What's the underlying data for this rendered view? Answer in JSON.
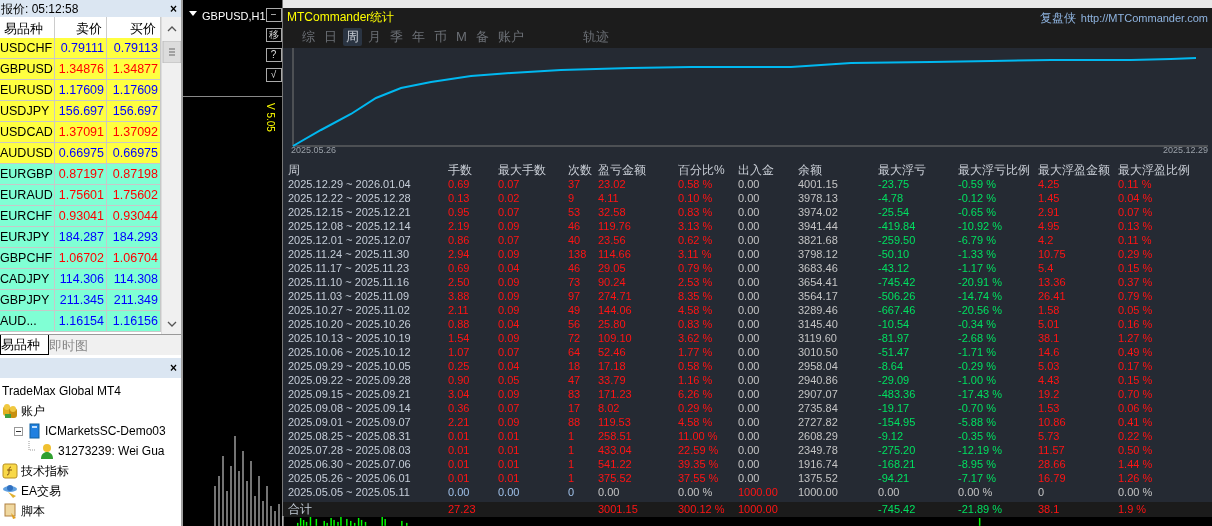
{
  "quotes": {
    "title": "报价: 05:12:58",
    "close": "×",
    "columns": [
      "易品种",
      "卖价",
      "买价"
    ],
    "rows": [
      {
        "symbol": "USDCHF",
        "bid": "0.79111",
        "ask": "0.79113",
        "kind": "major",
        "color": "#0000ff"
      },
      {
        "symbol": "GBPUSD",
        "bid": "1.34876",
        "ask": "1.34877",
        "kind": "major",
        "color": "#ff0000"
      },
      {
        "symbol": "EURUSD",
        "bid": "1.17609",
        "ask": "1.17609",
        "kind": "major",
        "color": "#0000ff"
      },
      {
        "symbol": "USDJPY",
        "bid": "156.697",
        "ask": "156.697",
        "kind": "major",
        "color": "#0000ff"
      },
      {
        "symbol": "USDCAD",
        "bid": "1.37091",
        "ask": "1.37092",
        "kind": "major",
        "color": "#ff0000"
      },
      {
        "symbol": "AUDUSD",
        "bid": "0.66975",
        "ask": "0.66975",
        "kind": "major",
        "color": "#0000ff"
      },
      {
        "symbol": "EURGBP",
        "bid": "0.87197",
        "ask": "0.87198",
        "kind": "cross",
        "color": "#ff0000"
      },
      {
        "symbol": "EURAUD",
        "bid": "1.75601",
        "ask": "1.75602",
        "kind": "cross",
        "color": "#ff0000"
      },
      {
        "symbol": "EURCHF",
        "bid": "0.93041",
        "ask": "0.93044",
        "kind": "cross",
        "color": "#ff0000"
      },
      {
        "symbol": "EURJPY",
        "bid": "184.287",
        "ask": "184.293",
        "kind": "cross",
        "color": "#0000ff"
      },
      {
        "symbol": "GBPCHF",
        "bid": "1.06702",
        "ask": "1.06704",
        "kind": "cross",
        "color": "#ff0000"
      },
      {
        "symbol": "CADJPY",
        "bid": "114.306",
        "ask": "114.308",
        "kind": "cross",
        "color": "#0000ff"
      },
      {
        "symbol": "GBPJPY",
        "bid": "211.345",
        "ask": "211.349",
        "kind": "cross",
        "color": "#0000ff"
      },
      {
        "symbol": "AUD...",
        "bid": "1.16154",
        "ask": "1.16156",
        "kind": "cross",
        "color": "#0000ff"
      }
    ]
  },
  "quote_tabs": [
    {
      "label": "易品种",
      "selected": true
    },
    {
      "label": "即时图",
      "selected": false
    }
  ],
  "navigator": {
    "close": "×",
    "root": "TradeMax Global MT4",
    "items": [
      {
        "label": "账户",
        "kind": "accounts",
        "children": [
          {
            "label": "ICMarketsSC-Demo03",
            "kind": "server",
            "expanded": true,
            "children": [
              {
                "label": "31273239: Wei Gua",
                "kind": "user"
              }
            ]
          }
        ]
      },
      {
        "label": "技术指标",
        "kind": "indicators"
      },
      {
        "label": "EA交易",
        "kind": "experts"
      },
      {
        "label": "脚本",
        "kind": "scripts"
      }
    ]
  },
  "chart_window": {
    "title": "GBPUSD,H1",
    "buttons": [
      "−",
      "移",
      "?",
      "√"
    ],
    "version": "V 5.05"
  },
  "stats": {
    "title": "MTCommander统计",
    "brand": "复盘侠",
    "url": "http://MTCommander.com",
    "tabs": [
      {
        "label": "综",
        "selected": false
      },
      {
        "label": "日",
        "selected": false
      },
      {
        "label": "周",
        "selected": true
      },
      {
        "label": "月",
        "selected": false
      },
      {
        "label": "季",
        "selected": false
      },
      {
        "label": "年",
        "selected": false
      },
      {
        "label": "币",
        "selected": false
      },
      {
        "label": "M",
        "selected": false
      },
      {
        "label": "备",
        "selected": false
      },
      {
        "label": "账户",
        "selected": false
      },
      {
        "label": "轨迹",
        "selected": false
      }
    ],
    "equity_chart": {
      "start_label": "2025.05.26",
      "end_label": "2025.12.29"
    },
    "table": {
      "columns": [
        "周",
        "手数",
        "最大手数",
        "次数",
        "盈亏金额",
        "百分比%",
        "出入金",
        "余额",
        "最大浮亏",
        "最大浮亏比例",
        "最大浮盈金额",
        "最大浮盈比例"
      ],
      "rows": [
        {
          "kind": "trade",
          "cells": [
            "2025.12.29 ~ 2026.01.04",
            "0.69",
            "0.07",
            "37",
            "23.02",
            "0.58 %",
            "0.00",
            "4001.15",
            "-23.75",
            "-0.59 %",
            "4.25",
            "0.11 %"
          ]
        },
        {
          "kind": "trade",
          "cells": [
            "2025.12.22 ~ 2025.12.28",
            "0.13",
            "0.02",
            "9",
            "4.11",
            "0.10 %",
            "0.00",
            "3978.13",
            "-4.78",
            "-0.12 %",
            "1.45",
            "0.04 %"
          ]
        },
        {
          "kind": "trade",
          "cells": [
            "2025.12.15 ~ 2025.12.21",
            "0.95",
            "0.07",
            "53",
            "32.58",
            "0.83 %",
            "0.00",
            "3974.02",
            "-25.54",
            "-0.65 %",
            "2.91",
            "0.07 %"
          ]
        },
        {
          "kind": "trade",
          "cells": [
            "2025.12.08 ~ 2025.12.14",
            "2.19",
            "0.09",
            "46",
            "119.76",
            "3.13 %",
            "0.00",
            "3941.44",
            "-419.84",
            "-10.92 %",
            "4.95",
            "0.13 %"
          ]
        },
        {
          "kind": "trade",
          "cells": [
            "2025.12.01 ~ 2025.12.07",
            "0.86",
            "0.07",
            "40",
            "23.56",
            "0.62 %",
            "0.00",
            "3821.68",
            "-259.50",
            "-6.79 %",
            "4.2",
            "0.11 %"
          ]
        },
        {
          "kind": "trade",
          "cells": [
            "2025.11.24 ~ 2025.11.30",
            "2.94",
            "0.09",
            "138",
            "114.66",
            "3.11 %",
            "0.00",
            "3798.12",
            "-50.10",
            "-1.33 %",
            "10.75",
            "0.29 %"
          ]
        },
        {
          "kind": "trade",
          "cells": [
            "2025.11.17 ~ 2025.11.23",
            "0.69",
            "0.04",
            "46",
            "29.05",
            "0.79 %",
            "0.00",
            "3683.46",
            "-43.12",
            "-1.17 %",
            "5.4",
            "0.15 %"
          ]
        },
        {
          "kind": "trade",
          "cells": [
            "2025.11.10 ~ 2025.11.16",
            "2.50",
            "0.09",
            "73",
            "90.24",
            "2.53 %",
            "0.00",
            "3654.41",
            "-745.42",
            "-20.91 %",
            "13.36",
            "0.37 %"
          ]
        },
        {
          "kind": "trade",
          "cells": [
            "2025.11.03 ~ 2025.11.09",
            "3.88",
            "0.09",
            "97",
            "274.71",
            "8.35 %",
            "0.00",
            "3564.17",
            "-506.26",
            "-14.74 %",
            "26.41",
            "0.79 %"
          ]
        },
        {
          "kind": "trade",
          "cells": [
            "2025.10.27 ~ 2025.11.02",
            "2.11",
            "0.09",
            "49",
            "144.06",
            "4.58 %",
            "0.00",
            "3289.46",
            "-667.46",
            "-20.56 %",
            "1.58",
            "0.05 %"
          ]
        },
        {
          "kind": "trade",
          "cells": [
            "2025.10.20 ~ 2025.10.26",
            "0.88",
            "0.04",
            "56",
            "25.80",
            "0.83 %",
            "0.00",
            "3145.40",
            "-10.54",
            "-0.34 %",
            "5.01",
            "0.16 %"
          ]
        },
        {
          "kind": "trade",
          "cells": [
            "2025.10.13 ~ 2025.10.19",
            "1.54",
            "0.09",
            "72",
            "109.10",
            "3.62 %",
            "0.00",
            "3119.60",
            "-81.97",
            "-2.68 %",
            "38.1",
            "1.27 %"
          ]
        },
        {
          "kind": "trade",
          "cells": [
            "2025.10.06 ~ 2025.10.12",
            "1.07",
            "0.07",
            "64",
            "52.46",
            "1.77 %",
            "0.00",
            "3010.50",
            "-51.47",
            "-1.71 %",
            "14.6",
            "0.49 %"
          ]
        },
        {
          "kind": "trade",
          "cells": [
            "2025.09.29 ~ 2025.10.05",
            "0.25",
            "0.04",
            "18",
            "17.18",
            "0.58 %",
            "0.00",
            "2958.04",
            "-8.64",
            "-0.29 %",
            "5.03",
            "0.17 %"
          ]
        },
        {
          "kind": "trade",
          "cells": [
            "2025.09.22 ~ 2025.09.28",
            "0.90",
            "0.05",
            "47",
            "33.79",
            "1.16 %",
            "0.00",
            "2940.86",
            "-29.09",
            "-1.00 %",
            "4.43",
            "0.15 %"
          ]
        },
        {
          "kind": "trade",
          "cells": [
            "2025.09.15 ~ 2025.09.21",
            "3.04",
            "0.09",
            "83",
            "171.23",
            "6.26 %",
            "0.00",
            "2907.07",
            "-483.36",
            "-17.43 %",
            "19.2",
            "0.70 %"
          ]
        },
        {
          "kind": "trade",
          "cells": [
            "2025.09.08 ~ 2025.09.14",
            "0.36",
            "0.07",
            "17",
            "8.02",
            "0.29 %",
            "0.00",
            "2735.84",
            "-19.17",
            "-0.70 %",
            "1.53",
            "0.06 %"
          ]
        },
        {
          "kind": "trade",
          "cells": [
            "2025.09.01 ~ 2025.09.07",
            "2.21",
            "0.09",
            "88",
            "119.53",
            "4.58 %",
            "0.00",
            "2727.82",
            "-154.95",
            "-5.88 %",
            "10.86",
            "0.41 %"
          ]
        },
        {
          "kind": "trade",
          "cells": [
            "2025.08.25 ~ 2025.08.31",
            "0.01",
            "0.01",
            "1",
            "258.51",
            "11.00 %",
            "0.00",
            "2608.29",
            "-9.12",
            "-0.35 %",
            "5.73",
            "0.22 %"
          ]
        },
        {
          "kind": "trade",
          "cells": [
            "2025.07.28 ~ 2025.08.03",
            "0.01",
            "0.01",
            "1",
            "433.04",
            "22.59 %",
            "0.00",
            "2349.78",
            "-275.20",
            "-12.19 %",
            "11.57",
            "0.50 %"
          ]
        },
        {
          "kind": "trade",
          "cells": [
            "2025.06.30 ~ 2025.07.06",
            "0.01",
            "0.01",
            "1",
            "541.22",
            "39.35 %",
            "0.00",
            "1916.74",
            "-168.21",
            "-8.95 %",
            "28.66",
            "1.44 %"
          ]
        },
        {
          "kind": "trade",
          "cells": [
            "2025.05.26 ~ 2025.06.01",
            "0.01",
            "0.01",
            "1",
            "375.52",
            "37.55 %",
            "0.00",
            "1375.52",
            "-94.21",
            "-7.17 %",
            "16.79",
            "1.26 %"
          ]
        },
        {
          "kind": "deposit",
          "cells": [
            "2025.05.05 ~ 2025.05.11",
            "0.00",
            "0.00",
            "0",
            "0.00",
            "0.00 %",
            "1000.00",
            "1000.00",
            "0.00",
            "0.00 %",
            "0",
            "0.00 %"
          ]
        }
      ],
      "total": {
        "cells": [
          "合计",
          "27.23",
          null,
          null,
          "3001.15",
          "300.12 %",
          "1000.00",
          null,
          "-745.42",
          "-21.89 %",
          "38.1",
          "1.9 %"
        ]
      }
    }
  }
}
